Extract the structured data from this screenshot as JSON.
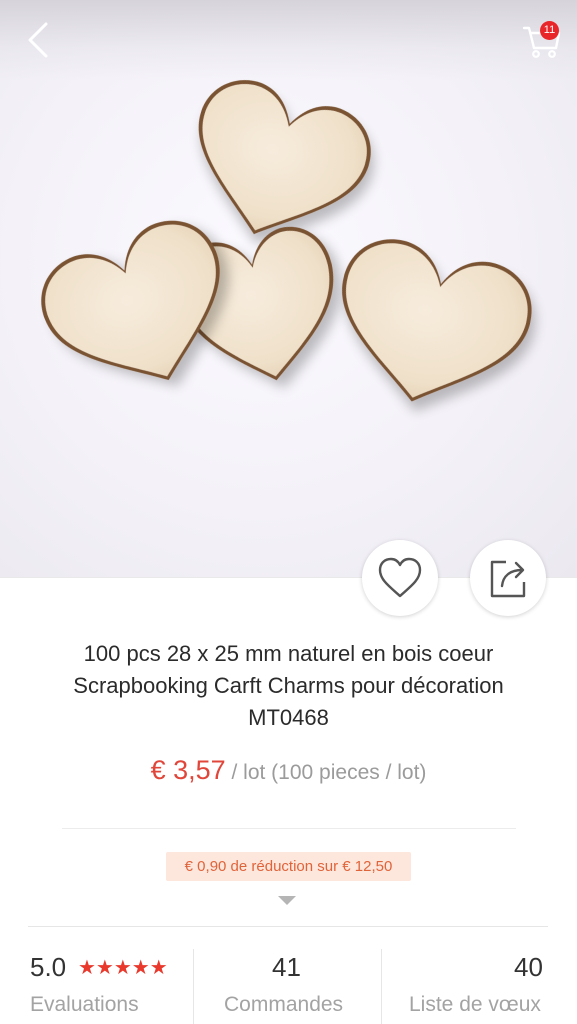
{
  "header": {
    "back_icon": "chevron-left-icon",
    "cart_icon": "shopping-cart-icon",
    "cart_count": "11"
  },
  "product_image": {
    "description_icon": "wooden-hearts-photo"
  },
  "actions": {
    "favorite_icon": "heart-outline-icon",
    "share_icon": "share-icon"
  },
  "product": {
    "title_line1": "100 pcs 28 x 25 mm naturel en bois coeur",
    "title_line2": "Scrapbooking Carft Charms pour décoration",
    "title_line3": "MT0468",
    "price": "€ 3,57",
    "unit": " / lot (100 pieces / lot)",
    "coupon": "€ 0,90 de réduction sur € 12,50"
  },
  "stats": {
    "rating": "5.0",
    "rating_stars": 5,
    "rating_label": "Evaluations",
    "orders": "41",
    "orders_label": "Commandes",
    "wishlist": "40",
    "wishlist_label": "Liste de vœux"
  },
  "colors": {
    "price": "#e0463a",
    "badge": "#e8262a",
    "coupon_bg": "#fde6dc",
    "coupon_text": "#e0643a",
    "stars": "#e8392c"
  }
}
